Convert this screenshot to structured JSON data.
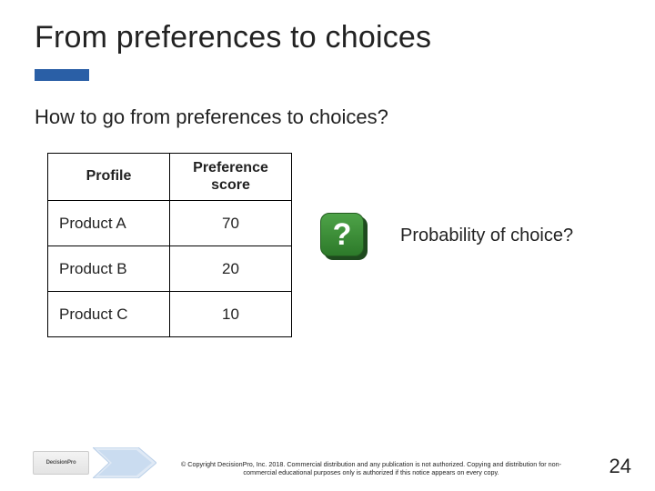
{
  "title": "From preferences to choices",
  "subtitle": "How to go from preferences to choices?",
  "table": {
    "headers": {
      "profile": "Profile",
      "score": "Preference\nscore"
    },
    "rows": [
      {
        "profile": "Product A",
        "score": "70"
      },
      {
        "profile": "Product B",
        "score": "20"
      },
      {
        "profile": "Product C",
        "score": "10"
      }
    ]
  },
  "question_mark": "?",
  "probability_label": "Probability of choice?",
  "logo_text": "DecisionPro",
  "copyright": "© Copyright DecisionPro, Inc. 2018. Commercial distribution and any publication is not authorized. Copying and distribution for non-commercial educational purposes only is authorized if this notice appears on every copy.",
  "page_number": "24",
  "colors": {
    "accent": "#2a5fa6",
    "qmark_bg": "#3d9438"
  },
  "chart_data": {
    "type": "table",
    "columns": [
      "Profile",
      "Preference score"
    ],
    "rows": [
      [
        "Product A",
        70
      ],
      [
        "Product B",
        20
      ],
      [
        "Product C",
        10
      ]
    ]
  }
}
